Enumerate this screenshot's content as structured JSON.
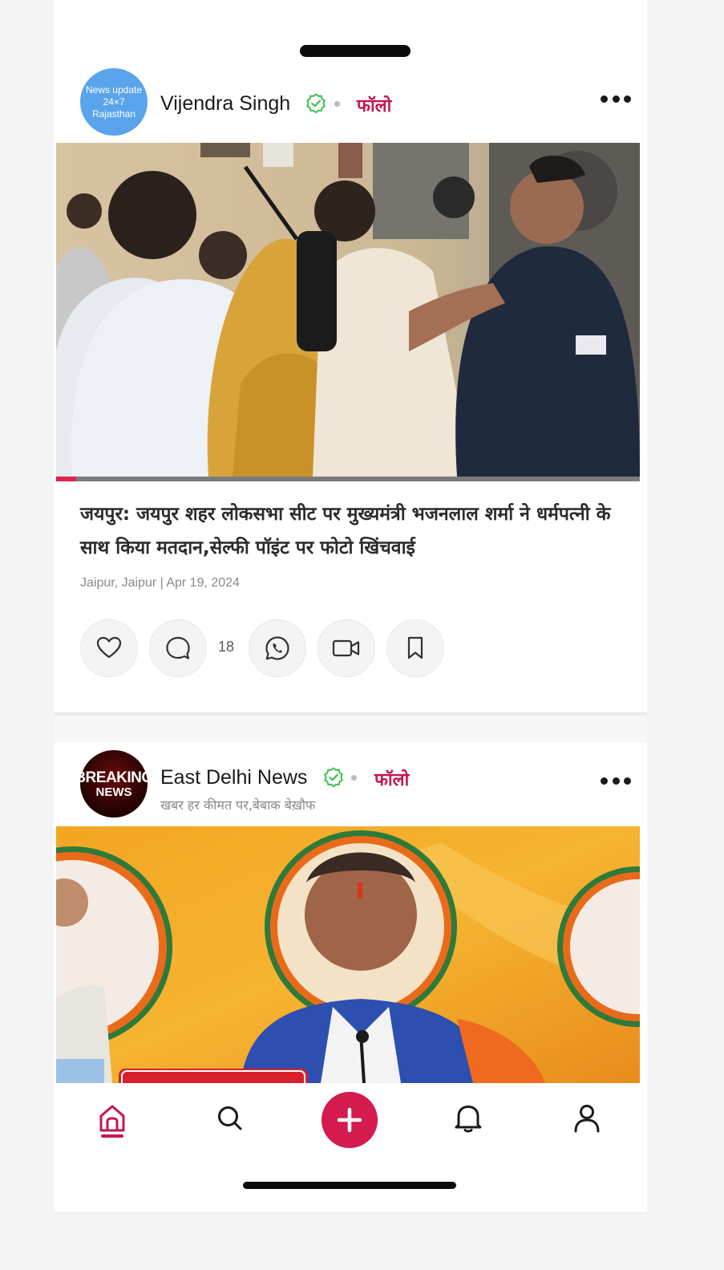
{
  "feed": {
    "posts": [
      {
        "author": {
          "name": "Vijendra Singh",
          "avatar_lines": [
            "News update",
            "24×7",
            "Rajasthan"
          ],
          "verified": true,
          "follow_label": "फॉलो"
        },
        "media": {
          "kind": "video",
          "progress": 0.035
        },
        "headline": "जयपुर: जयपुर शहर लोकसभा सीट पर मुख्यमंत्री भजनलाल शर्मा ने धर्मपत्नी के साथ किया मतदान,सेल्फी पॉइंट पर फोटो खिंचवाई",
        "meta": "Jaipur, Jaipur | Apr 19, 2024",
        "actions": {
          "like_icon": "heart-icon",
          "comment_icon": "comment-icon",
          "comment_count": "18",
          "share_icon": "whatsapp-icon",
          "video_icon": "video-camera-icon",
          "bookmark_icon": "bookmark-icon"
        }
      },
      {
        "author": {
          "name": "East Delhi News",
          "avatar_lines": [
            "BREAKING",
            "NEWS"
          ],
          "verified": true,
          "follow_label": "फॉलो",
          "tagline": "खबर हर कीमत पर,बेबाक बेख़ौफ"
        },
        "media": {
          "kind": "video"
        }
      }
    ]
  },
  "bottom_nav": {
    "items": [
      {
        "id": "home",
        "icon": "home-icon",
        "active": true
      },
      {
        "id": "search",
        "icon": "search-icon",
        "active": false
      },
      {
        "id": "create",
        "icon": "plus-icon",
        "active": false
      },
      {
        "id": "notifications",
        "icon": "bell-icon",
        "active": false
      },
      {
        "id": "profile",
        "icon": "user-icon",
        "active": false
      }
    ]
  },
  "colors": {
    "accent": "#c51650",
    "create_button": "#d51a50",
    "verified": "#3fbf4f",
    "avatar_blue": "#5aa4ec",
    "progress": "#e0224f"
  }
}
